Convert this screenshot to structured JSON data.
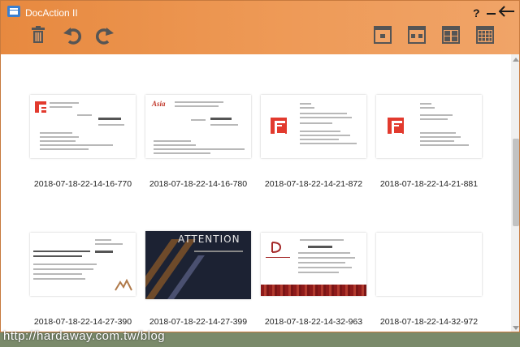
{
  "window": {
    "title": "DocAction II",
    "help_label": "?"
  },
  "toolbar": {
    "left_icons": [
      "trash-icon",
      "undo-icon",
      "redo-icon"
    ],
    "view_icons": [
      "single-view-icon",
      "two-column-view-icon",
      "four-grid-view-icon",
      "many-grid-view-icon"
    ],
    "accent_color": "#e7893f"
  },
  "thumbnails": [
    {
      "caption": "2018-07-18-22-14-16-770",
      "style": "redE-left"
    },
    {
      "caption": "2018-07-18-22-14-16-780",
      "style": "asia"
    },
    {
      "caption": "2018-07-18-22-14-21-872",
      "style": "redE-mid"
    },
    {
      "caption": "2018-07-18-22-14-21-881",
      "style": "redE-mid2"
    },
    {
      "caption": "2018-07-18-22-14-27-390",
      "style": "attention-white"
    },
    {
      "caption": "2018-07-18-22-14-27-399",
      "style": "attention-dark"
    },
    {
      "caption": "2018-07-18-22-14-32-963",
      "style": "redband"
    },
    {
      "caption": "2018-07-18-22-14-32-972",
      "style": "blank"
    }
  ],
  "watermark": "http://hardaway.com.tw/blog"
}
